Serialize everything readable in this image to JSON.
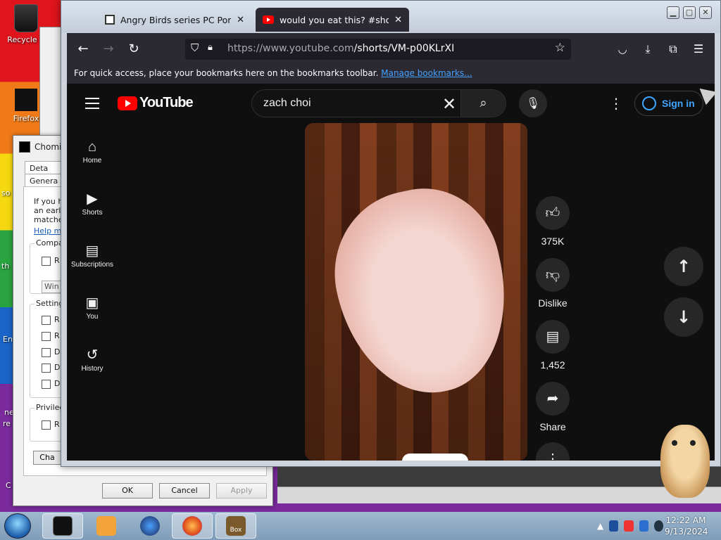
{
  "desktop": {
    "recycle_bin_label": "Recycle B",
    "firefox_label": "Firefox",
    "edge_fragments": [
      "so",
      "th",
      "En",
      "ne",
      "re",
      "C"
    ]
  },
  "dialog": {
    "title": "Chomi",
    "tabs": [
      "Deta",
      "Genera"
    ],
    "intro_lines": [
      "If you ha",
      "an earlie",
      "matches"
    ],
    "help_link": "Help m",
    "groups": {
      "compat": {
        "label": "Compa",
        "checkbox_label": "R",
        "combo_value": "Win"
      },
      "settings": {
        "label": "Setting",
        "checkbox_labels": [
          "R",
          "R",
          "D",
          "D",
          "D"
        ]
      },
      "privilege": {
        "label": "Privileg",
        "checkbox_label": "R"
      }
    },
    "change_button": "Cha",
    "ok_button": "OK",
    "cancel_button": "Cancel",
    "apply_button": "Apply"
  },
  "browser": {
    "tabs": [
      {
        "title": "Angry Birds series PC Ports : Ro",
        "favicon": "fandom-icon"
      },
      {
        "title": "would you eat this? #shorts - Y",
        "favicon": "youtube-icon"
      }
    ],
    "url": {
      "prefix": "https://www.youtube.com",
      "path": "/shorts/VM-p00KLrXI"
    },
    "bookmarks_bar": {
      "message": "For quick access, place your bookmarks here on the bookmarks toolbar.",
      "link": "Manage bookmarks..."
    }
  },
  "youtube": {
    "logo_text": "YouTube",
    "search_query": "zach choi",
    "signin_label": "Sign in",
    "sidebar": [
      {
        "label": "Home",
        "icon": "home-icon",
        "glyph": "⌂"
      },
      {
        "label": "Shorts",
        "icon": "shorts-icon",
        "glyph": "▶"
      },
      {
        "label": "Subscriptions",
        "icon": "subscriptions-icon",
        "glyph": "▤"
      },
      {
        "label": "You",
        "icon": "library-icon",
        "glyph": "▣"
      },
      {
        "label": "History",
        "icon": "history-icon",
        "glyph": "↺"
      }
    ],
    "actions": {
      "likes": "375K",
      "dislike": "Dislike",
      "comments": "1,452",
      "share": "Share"
    }
  },
  "taskbar": {
    "clock_time": "12:22 AM",
    "clock_date": "9/13/2024",
    "app_box_label": "Box"
  }
}
